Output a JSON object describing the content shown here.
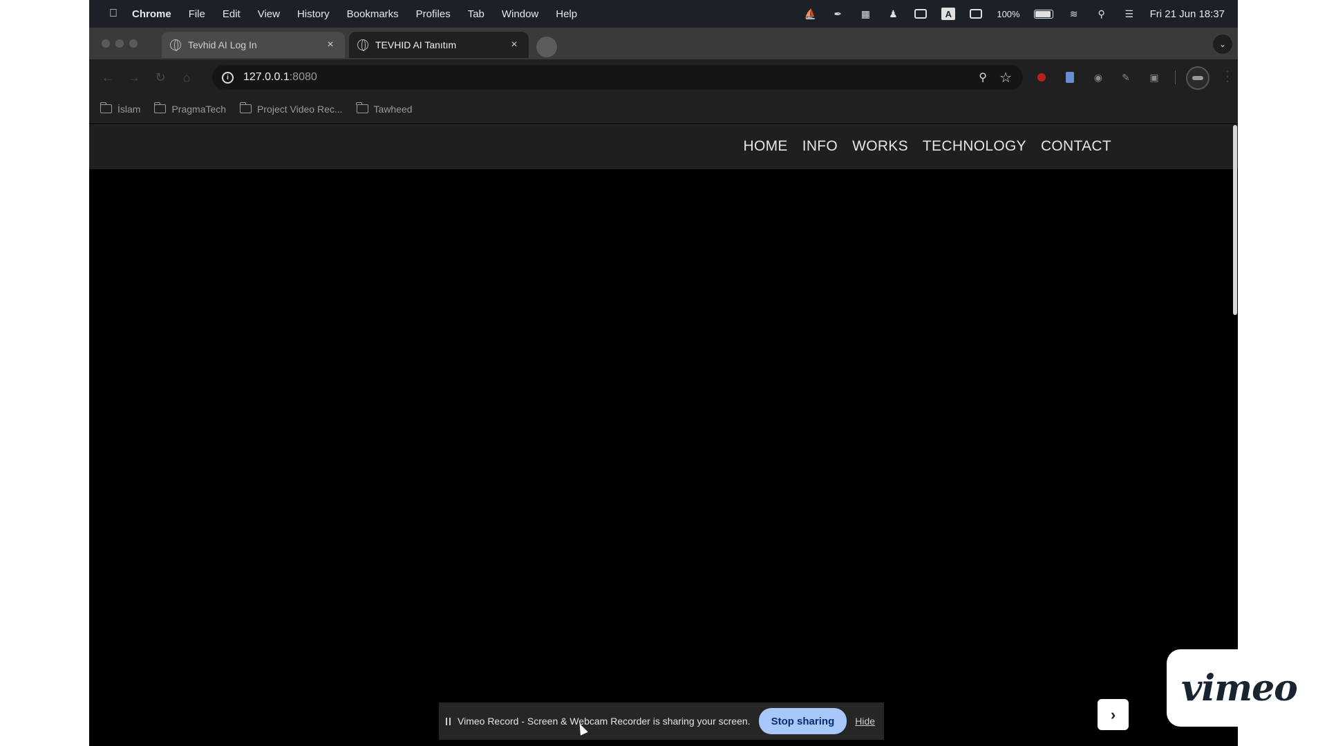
{
  "menubar": {
    "app": "Chrome",
    "items": [
      "File",
      "Edit",
      "View",
      "History",
      "Bookmarks",
      "Profiles",
      "Tab",
      "Window",
      "Help"
    ],
    "battery_pct": "100%",
    "clock": "Fri 21 Jun  18:37",
    "status_icons": [
      "docker-icon",
      "feather-icon",
      "layout-icon",
      "person-icon",
      "windows-icon",
      "input-source-icon",
      "screen-mirror-icon",
      "battery-icon",
      "wifi-icon",
      "spotlight-icon",
      "control-center-icon"
    ]
  },
  "tabs": [
    {
      "label": "Tevhid AI Log In",
      "active": false
    },
    {
      "label": "TEVHID AI Tanıtım",
      "active": true
    }
  ],
  "address_bar": {
    "host": "127.0.0.1",
    "port": ":8080"
  },
  "bookmarks": [
    "İslam",
    "PragmaTech",
    "Project Video Rec...",
    "Tawheed"
  ],
  "site_nav": {
    "items": [
      "HOME",
      "INFO",
      "WORKS",
      "TECHNOLOGY",
      "CONTACT"
    ]
  },
  "sharing_bar": {
    "message": "Vimeo Record - Screen & Webcam Recorder is sharing your screen.",
    "stop_label": "Stop sharing",
    "hide_label": "Hide"
  },
  "overlay": {
    "brand": "vimeo",
    "next_label": "›"
  },
  "colors": {
    "page_bg": "#000000",
    "nav_bg": "#1f1f1f",
    "stop_button": "#a8c7fa"
  }
}
